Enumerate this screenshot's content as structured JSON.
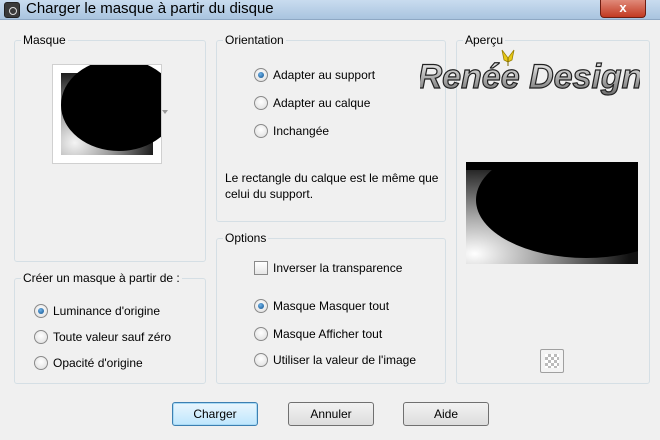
{
  "window": {
    "title": "Charger le masque à partir du disque",
    "close_label": "x"
  },
  "mask_group": {
    "legend": "Masque"
  },
  "create_group": {
    "legend": "Créer un masque à partir de :",
    "options": [
      {
        "label": "Luminance d'origine",
        "checked": true
      },
      {
        "label": "Toute valeur sauf zéro",
        "checked": false
      },
      {
        "label": "Opacité d'origine",
        "checked": false
      }
    ]
  },
  "orientation_group": {
    "legend": "Orientation",
    "options": [
      {
        "label": "Adapter au support",
        "checked": true
      },
      {
        "label": "Adapter au calque",
        "checked": false
      },
      {
        "label": "Inchangée",
        "checked": false
      }
    ],
    "info": "Le rectangle du calque est le même que celui du support."
  },
  "options_group": {
    "legend": "Options",
    "invert_label": "Inverser la transparence",
    "invert_checked": false,
    "mode_options": [
      {
        "label": "Masque Masquer tout",
        "checked": true
      },
      {
        "label": "Masque Afficher tout",
        "checked": false
      },
      {
        "label": "Utiliser la valeur de l'image",
        "checked": false
      }
    ]
  },
  "preview_group": {
    "legend": "Aperçu",
    "watermark": "Renée Design"
  },
  "buttons": {
    "load": "Charger",
    "cancel": "Annuler",
    "help": "Aide"
  },
  "icons": {
    "app": "app-icon",
    "transparency": "checkerboard-icon"
  }
}
